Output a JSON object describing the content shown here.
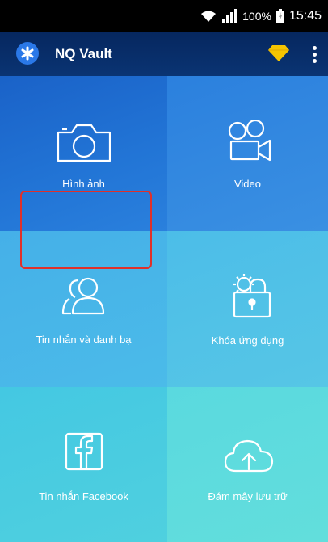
{
  "status_bar": {
    "battery_percent": "100%",
    "time": "15:45",
    "icons": [
      "wifi-icon",
      "signal-icon",
      "battery-icon"
    ]
  },
  "app_bar": {
    "title": "NQ Vault",
    "icons": [
      "app-logo-icon",
      "premium-diamond-icon",
      "overflow-menu-icon"
    ],
    "diamond_color": "#f5c400"
  },
  "tiles": [
    {
      "label": "Hình ảnh",
      "icon": "camera-icon"
    },
    {
      "label": "Video",
      "icon": "video-camera-icon"
    },
    {
      "label": "Tin nhắn và danh bạ",
      "icon": "contacts-icon",
      "highlighted": true
    },
    {
      "label": "Khóa ứng dụng",
      "icon": "app-lock-icon"
    },
    {
      "label": "Tin nhắn Facebook",
      "icon": "facebook-icon"
    },
    {
      "label": "Đám mây lưu trữ",
      "icon": "cloud-upload-icon"
    }
  ],
  "highlight_color": "#e0302a"
}
